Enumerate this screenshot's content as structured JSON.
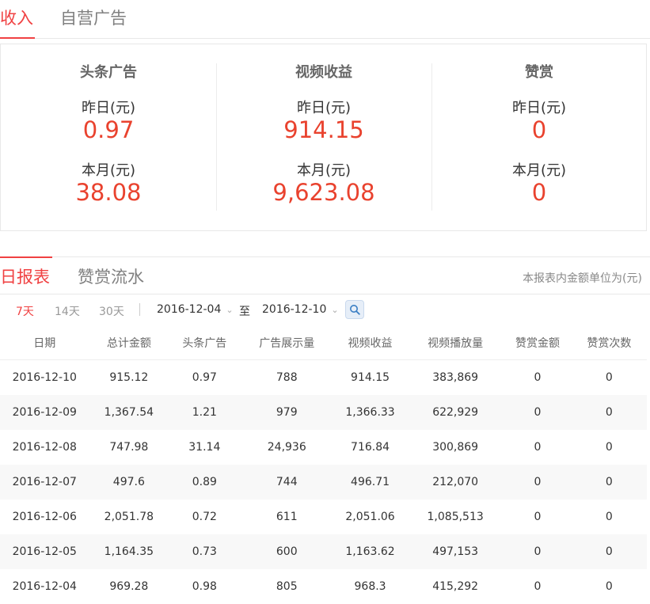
{
  "top_tabs": {
    "income": "收入",
    "self_ads": "自营广告"
  },
  "summary": [
    {
      "title": "头条广告",
      "yesterday_label": "昨日(元)",
      "yesterday": "0.97",
      "month_label": "本月(元)",
      "month": "38.08"
    },
    {
      "title": "视频收益",
      "yesterday_label": "昨日(元)",
      "yesterday": "914.15",
      "month_label": "本月(元)",
      "month": "9,623.08"
    },
    {
      "title": "赞赏",
      "yesterday_label": "昨日(元)",
      "yesterday": "0",
      "month_label": "本月(元)",
      "month": "0"
    }
  ],
  "report_tabs": {
    "daily": "日报表",
    "tips_flow": "赞赏流水"
  },
  "unit_note": "本报表内金额单位为(元)",
  "filter": {
    "ranges": [
      "7天",
      "14天",
      "30天"
    ],
    "start_date": "2016-12-04",
    "to_label": "至",
    "end_date": "2016-12-10"
  },
  "table": {
    "headers": [
      "日期",
      "总计金额",
      "头条广告",
      "广告展示量",
      "视频收益",
      "视频播放量",
      "赞赏金额",
      "赞赏次数"
    ],
    "rows": [
      [
        "2016-12-10",
        "915.12",
        "0.97",
        "788",
        "914.15",
        "383,869",
        "0",
        "0"
      ],
      [
        "2016-12-09",
        "1,367.54",
        "1.21",
        "979",
        "1,366.33",
        "622,929",
        "0",
        "0"
      ],
      [
        "2016-12-08",
        "747.98",
        "31.14",
        "24,936",
        "716.84",
        "300,869",
        "0",
        "0"
      ],
      [
        "2016-12-07",
        "497.6",
        "0.89",
        "744",
        "496.71",
        "212,070",
        "0",
        "0"
      ],
      [
        "2016-12-06",
        "2,051.78",
        "0.72",
        "611",
        "2,051.06",
        "1,085,513",
        "0",
        "0"
      ],
      [
        "2016-12-05",
        "1,164.35",
        "0.73",
        "600",
        "1,163.62",
        "497,153",
        "0",
        "0"
      ],
      [
        "2016-12-04",
        "969.28",
        "0.98",
        "805",
        "968.3",
        "415,292",
        "0",
        "0"
      ]
    ]
  },
  "colors": {
    "accent": "#f04142",
    "value": "#e9422e"
  }
}
